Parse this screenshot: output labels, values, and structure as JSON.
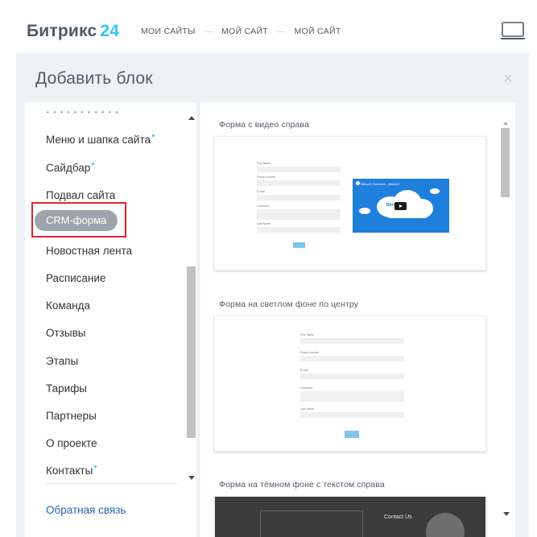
{
  "header": {
    "logo_name": "Битрикс",
    "logo_number": "24",
    "breadcrumbs": [
      "МОИ САЙТЫ",
      "МОЙ САЙТ",
      "МОЙ САЙТ"
    ],
    "separator": "—"
  },
  "modal": {
    "title": "Добавить блок",
    "close": "×"
  },
  "sidebar": {
    "items": [
      {
        "label": "Меню и шапка сайта",
        "new": true
      },
      {
        "label": "Сайдбар",
        "new": true
      },
      {
        "label": "Подвал сайта",
        "new": false
      },
      {
        "label": "CRM-форма",
        "new": false,
        "active": true
      },
      {
        "label": "Новостная лента",
        "new": false
      },
      {
        "label": "Расписание",
        "new": false
      },
      {
        "label": "Команда",
        "new": false
      },
      {
        "label": "Отзывы",
        "new": false
      },
      {
        "label": "Этапы",
        "new": false
      },
      {
        "label": "Тарифы",
        "new": false
      },
      {
        "label": "Партнеры",
        "new": false
      },
      {
        "label": "О проекте",
        "new": false
      },
      {
        "label": "Контакты",
        "new": true
      }
    ],
    "feedback": "Обратная связь",
    "highlight_color": "#e3232b",
    "dot_color": "#2fc6f6"
  },
  "blocks": [
    {
      "title": "Форма с видео справа",
      "form_labels": [
        "First Name",
        "Phone number",
        "E-mail",
        "Comment",
        "Last Name"
      ],
      "video_title": "Bitrix24 Overview - Bitrix24",
      "video_caption": "Bitri     s"
    },
    {
      "title": "Форма на светлом фоне по центру",
      "form_labels": [
        "First Name",
        "Phone number",
        "E-mail",
        "Comment",
        "Last Name"
      ]
    },
    {
      "title": "Форма на тёмном фоне с текстом справа",
      "dark_text": "Contact Us"
    }
  ],
  "colors": {
    "accent": "#2fc6f6",
    "link": "#2067b0",
    "active_pill": "#9ea4ab",
    "modal_bg": "#eef2f4"
  }
}
